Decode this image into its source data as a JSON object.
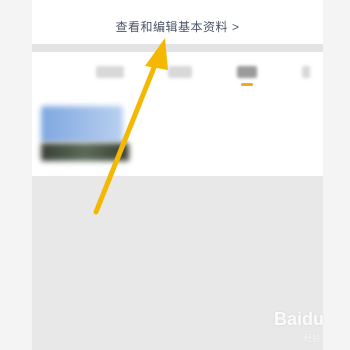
{
  "profile": {
    "edit_basic_info_label": "查看和编辑基本资料",
    "chevron_glyph": ">"
  },
  "annotation": {
    "arrow_color": "#f5b800"
  },
  "watermark": {
    "text": "Baidu",
    "subtext": "经验"
  },
  "colors": {
    "active_tab_underline": "#f5a623",
    "link_text": "#4a5568"
  }
}
